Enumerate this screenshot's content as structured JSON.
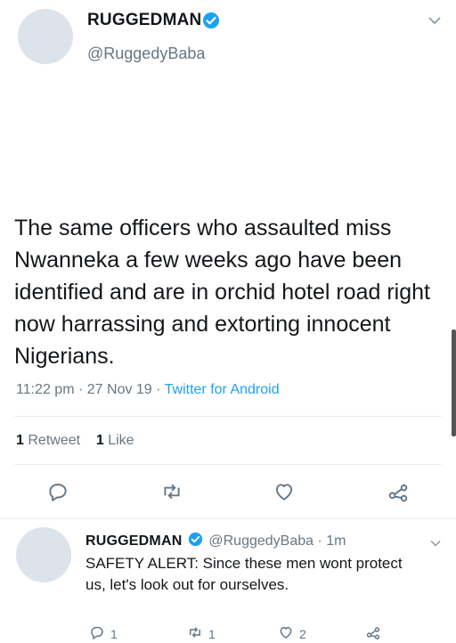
{
  "tweet": {
    "display_name": "RUGGEDMAN",
    "handle": "@RuggedyBaba",
    "text": "The same officers who assaulted miss Nwanneka a few weeks ago have been identified and are in orchid hotel road right now harrassing and extorting innocent Nigerians.",
    "time": "11:22 pm",
    "date": "27 Nov 19",
    "source": "Twitter for Android",
    "retweet_count": "1",
    "retweet_label": "Retweet",
    "like_count": "1",
    "like_label": "Like"
  },
  "reply": {
    "display_name": "RUGGEDMAN",
    "handle": "@RuggedyBaba",
    "age": "1m",
    "text": "SAFETY ALERT: Since these men wont protect us, let's look out for ourselves.",
    "reply_count": "1",
    "retweet_count": "1",
    "like_count": "2"
  },
  "colors": {
    "verified": "#1da1f2",
    "link": "#1da1f2",
    "secondary": "#657786"
  },
  "icons": [
    "verified-badge-icon",
    "chevron-down-icon",
    "reply-icon",
    "retweet-icon",
    "like-icon",
    "share-icon"
  ]
}
